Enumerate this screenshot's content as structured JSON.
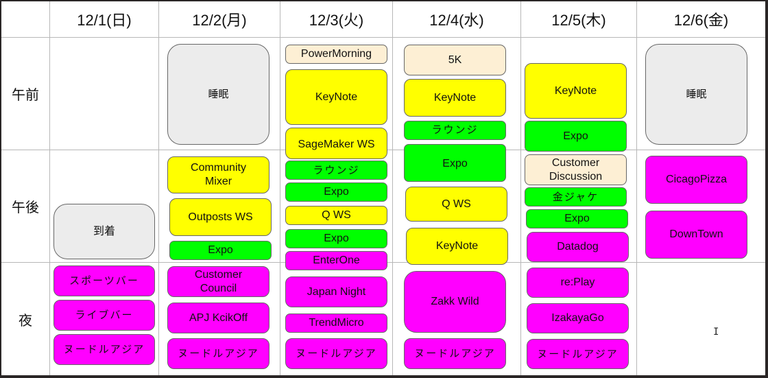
{
  "colors": {
    "sleep": "#ececec",
    "keynote_ws": "#ffff00",
    "expo_lounge": "#00ff00",
    "evening": "#ff00ff",
    "morning_misc": "#fdefd4"
  },
  "days": [
    "12/1(日)",
    "12/2(月)",
    "12/3(火)",
    "12/4(水)",
    "12/5(木)",
    "12/6(金)"
  ],
  "periods": [
    "午前",
    "午後",
    "夜"
  ],
  "events": {
    "d1": {
      "afternoon": [
        "到着"
      ],
      "night": [
        "スポーツバー",
        "ライブバー",
        "ヌードルアジア"
      ]
    },
    "d2": {
      "morning": [
        "睡眠"
      ],
      "afternoon": [
        "Community Mixer",
        "Outposts WS",
        "Expo"
      ],
      "night": [
        "Customer Council",
        "APJ KcikOff",
        "ヌードルアジア"
      ]
    },
    "d3": {
      "morning": [
        "PowerMorning",
        "KeyNote",
        "SageMaker WS"
      ],
      "afternoon": [
        "ラウンジ",
        "Expo",
        "Q WS",
        "Expo",
        "EnterOne"
      ],
      "night": [
        "Japan Night",
        "TrendMicro",
        "ヌードルアジア"
      ]
    },
    "d4": {
      "morning": [
        "5K",
        "KeyNote",
        "ラウンジ"
      ],
      "afternoon": [
        "Expo",
        "Q WS",
        "KeyNote"
      ],
      "night": [
        "Zakk Wild",
        "ヌードルアジア"
      ]
    },
    "d5": {
      "morning": [
        "KeyNote",
        "Expo"
      ],
      "afternoon": [
        "Customer Discussion",
        "金ジャケ",
        "Expo",
        "Datadog"
      ],
      "night": [
        "re:Play",
        "IzakayaGo",
        "ヌードルアジア"
      ]
    },
    "d6": {
      "morning": [
        "睡眠"
      ],
      "afternoon": [
        "CicagoPizza",
        "DownTown"
      ]
    }
  }
}
